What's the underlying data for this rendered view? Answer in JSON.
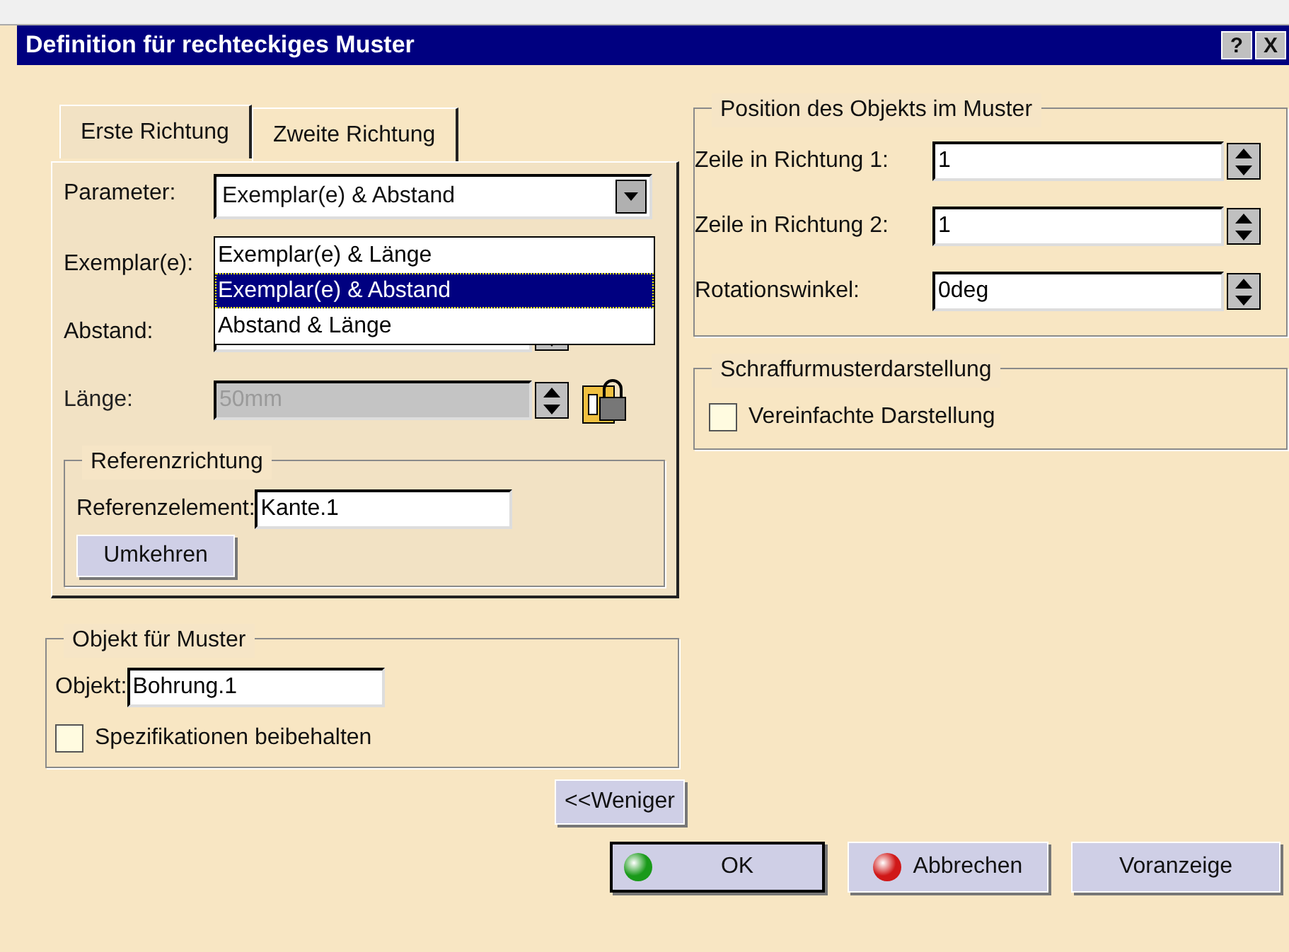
{
  "window": {
    "title": "Definition für rechteckiges Muster",
    "help": "?",
    "close": "X"
  },
  "tabs": [
    {
      "label": "Erste Richtung",
      "selected": true
    },
    {
      "label": "Zweite Richtung",
      "selected": false
    }
  ],
  "parameter": {
    "label": "Parameter:",
    "value": "Exemplar(e) & Abstand",
    "expanded": true,
    "options": [
      {
        "label": "Exemplar(e) & Länge",
        "selected": false
      },
      {
        "label": "Exemplar(e) & Abstand",
        "selected": true
      },
      {
        "label": "Abstand & Länge",
        "selected": false
      }
    ]
  },
  "fields": [
    {
      "label": "Exemplar(e):",
      "disabled": false
    },
    {
      "label": "Abstand:",
      "disabled": false
    },
    {
      "label": "Länge:",
      "value": "50mm",
      "disabled": true
    }
  ],
  "reference": {
    "title": "Referenzrichtung",
    "label": "Referenzelement:",
    "value": "Kante.1",
    "button": "Umkehren"
  },
  "object": {
    "title": "Objekt für Muster",
    "label": "Objekt:",
    "value": "Bohrung.1",
    "checkbox": {
      "label": "Spezifikationen beibehalten",
      "checked": false
    }
  },
  "less_button": "<<Weniger",
  "position": {
    "title": "Position des Objekts im Muster",
    "rows": [
      {
        "label": "Zeile in Richtung 1:",
        "value": "1"
      },
      {
        "label": "Zeile in Richtung 2:",
        "value": "1"
      },
      {
        "label": "Rotationswinkel:",
        "value": "0deg"
      }
    ]
  },
  "hatch": {
    "title": "Schraffurmusterdarstellung",
    "checkbox": {
      "label": "Vereinfachte Darstellung",
      "checked": false
    }
  },
  "buttons": [
    {
      "label": "OK",
      "kind": "ok"
    },
    {
      "label": "Abbrechen",
      "kind": "cancel"
    },
    {
      "label": "Voranzeige",
      "kind": "plain"
    }
  ]
}
